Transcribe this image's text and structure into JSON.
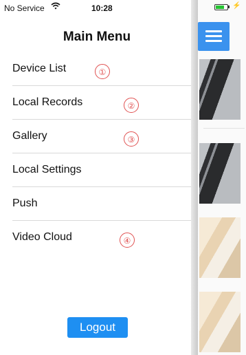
{
  "status_bar": {
    "carrier": "No Service",
    "time": "10:28"
  },
  "menu": {
    "title": "Main Menu",
    "items": [
      {
        "label": "Device List",
        "annotation": "①"
      },
      {
        "label": "Local Records",
        "annotation": "②"
      },
      {
        "label": "Gallery",
        "annotation": "③"
      },
      {
        "label": "Local Settings",
        "annotation": ""
      },
      {
        "label": "Push",
        "annotation": ""
      },
      {
        "label": "Video Cloud",
        "annotation": "④"
      }
    ],
    "logout_label": "Logout"
  },
  "colors": {
    "accent": "#1e8ff2",
    "header_button": "#3b92ee",
    "annotation": "#e05050",
    "battery": "#25c331"
  }
}
